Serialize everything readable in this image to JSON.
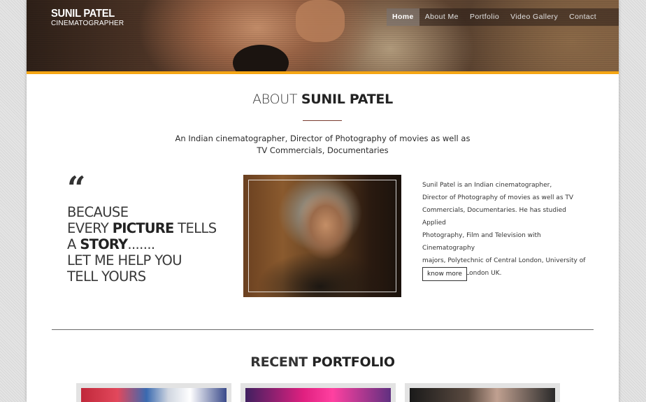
{
  "brand": {
    "name": "SUNIL PATEL",
    "title": "CINEMATOGRAPHER"
  },
  "nav": {
    "items": [
      {
        "label": "Home",
        "active": true
      },
      {
        "label": "About Me",
        "active": false
      },
      {
        "label": "Portfolio",
        "active": false
      },
      {
        "label": "Video Gallery",
        "active": false
      },
      {
        "label": "Contact",
        "active": false
      }
    ]
  },
  "about": {
    "heading_light": "ABOUT",
    "heading_bold": "SUNIL PATEL",
    "intro_line1": "An Indian cinematographer, Director of Photography of movies as well as",
    "intro_line2": "TV Commercials, Documentaries",
    "quote_mark": "“",
    "quote": {
      "l1": "BECAUSE",
      "l2a": "EVERY ",
      "l2b": "PICTURE",
      "l2c": " TELLS",
      "l3a": "A ",
      "l3b": "STORY",
      "l3c": ".......",
      "l4": "LET ME HELP YOU",
      "l5": "TELL YOURS"
    },
    "desc_lines": [
      "Sunil Patel is an Indian cinematographer,",
      "Director of Photography of movies as well as TV",
      "Commercials, Documentaries. He has studied Applied",
      "Photography, Film and Television with Cinematography",
      "majors, Polytechnic of Central London, University of",
      "Westminster, London UK."
    ],
    "button_label": "know more"
  },
  "portfolio": {
    "heading_light": "RECENT",
    "heading_bold": "PORTFOLIO"
  },
  "colors": {
    "accent_bar": "#f5a614",
    "heading_rule": "#7a3b30"
  }
}
